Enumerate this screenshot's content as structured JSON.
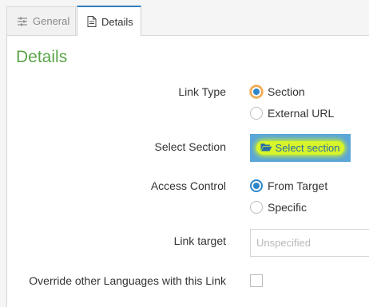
{
  "tabs": [
    {
      "label": "General",
      "icon": "sliders-icon",
      "active": false
    },
    {
      "label": "Details",
      "icon": "document-icon",
      "active": true
    }
  ],
  "section_title": "Details",
  "link_type": {
    "label": "Link Type",
    "options": [
      "Section",
      "External URL"
    ],
    "selected": "Section"
  },
  "select_section": {
    "label": "Select Section",
    "button_label": "Select section",
    "icon": "folder-open-icon"
  },
  "access_control": {
    "label": "Access Control",
    "options": [
      "From Target",
      "Specific"
    ],
    "selected": "From Target"
  },
  "link_target": {
    "label": "Link target",
    "placeholder": "Unspecified"
  },
  "override": {
    "label": "Override other Languages with this Link",
    "checked": false
  },
  "colors": {
    "accent": "#2e86c9",
    "title_green": "#5ba54a",
    "button_blue": "#5aa6d8",
    "highlight": "#d7f52a"
  }
}
